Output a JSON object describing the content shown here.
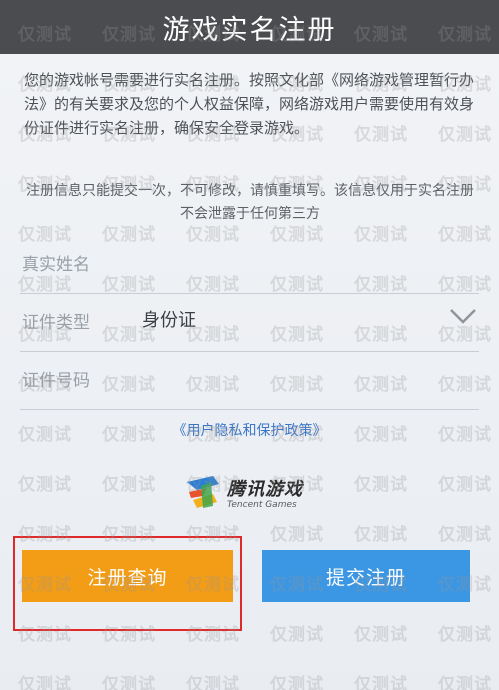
{
  "header": {
    "title": "游戏实名注册"
  },
  "intro": {
    "text": "您的游戏帐号需要进行实名注册。按照文化部《网络游戏管理暂行办法》的有关要求及您的个人权益保障，网络游戏用户需要使用有效身份证件进行实名注册，确保安全登录游戏。"
  },
  "note": {
    "text": "注册信息只能提交一次，不可修改，请慎重填写。该信息仅用于实名注册不会泄露于任何第三方"
  },
  "form": {
    "name_label": "真实姓名",
    "id_type_label": "证件类型",
    "id_type_value": "身份证",
    "id_number_label": "证件号码"
  },
  "privacy_link": "《用户隐私和保护政策》",
  "logo": {
    "name_cn": "腾讯游戏",
    "name_en": "Tencent Games"
  },
  "buttons": {
    "query_label": "注册查询",
    "submit_label": "提交注册"
  },
  "watermark": {
    "text": "仅测试"
  },
  "colors": {
    "header_bg": "#4a4c4f",
    "query_button": "#f39c15",
    "submit_button": "#3b96e3",
    "link": "#3b76c9",
    "highlight": "#e02a2a"
  }
}
